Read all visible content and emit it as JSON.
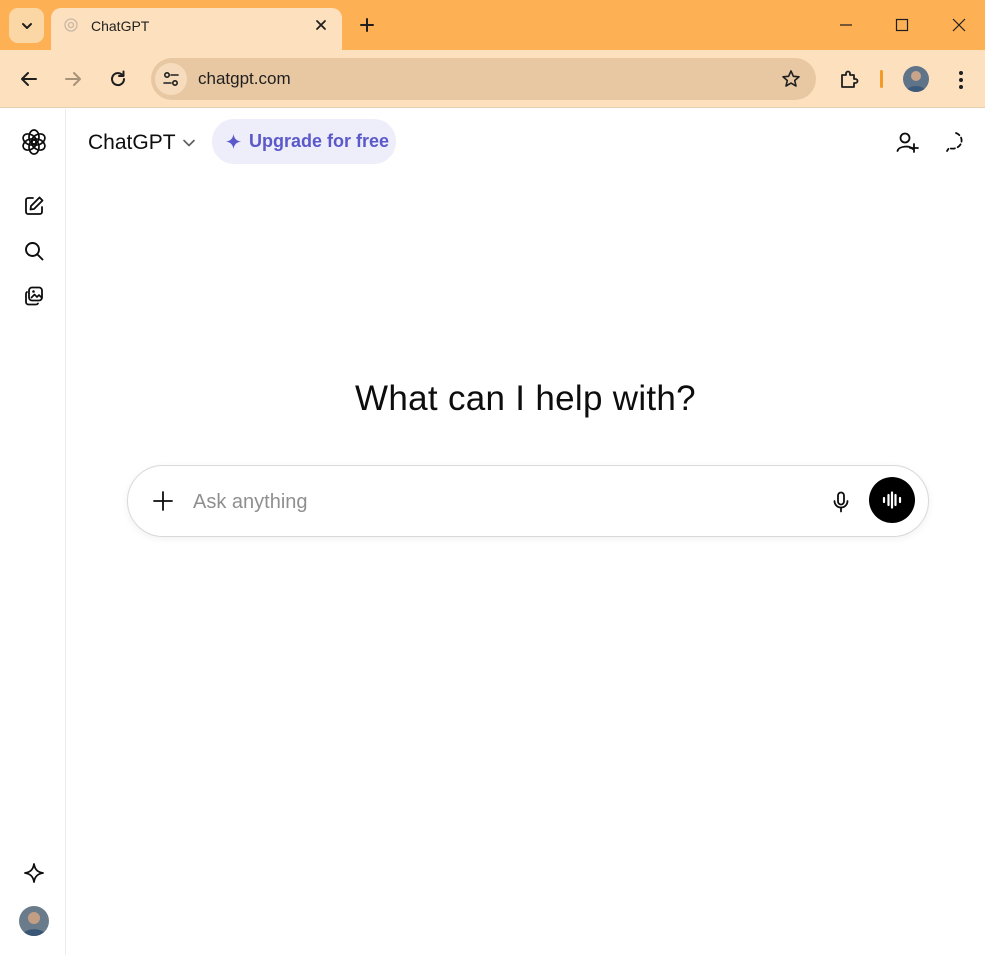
{
  "browser": {
    "tab": {
      "title": "ChatGPT"
    },
    "address": {
      "url": "chatgpt.com"
    },
    "colors": {
      "frame": "#fdb054",
      "toolbar": "#fde0bd",
      "omnibox": "#e7c8a3"
    }
  },
  "header": {
    "model_label": "ChatGPT",
    "upgrade_label": "Upgrade for free"
  },
  "main": {
    "heading": "What can I help with?",
    "composer": {
      "placeholder": "Ask anything"
    }
  },
  "icons": {
    "sidebar": [
      "openai-logo-icon",
      "new-chat-icon",
      "search-icon",
      "library-icon",
      "sparkle-icon",
      "avatar"
    ],
    "header": [
      "add-person-icon",
      "temporary-chat-icon"
    ],
    "composer": [
      "plus-icon",
      "microphone-icon",
      "voice-mode-icon"
    ]
  },
  "colors": {
    "accent": "#5b59c9",
    "upgrade_bg": "#eeeefb"
  }
}
